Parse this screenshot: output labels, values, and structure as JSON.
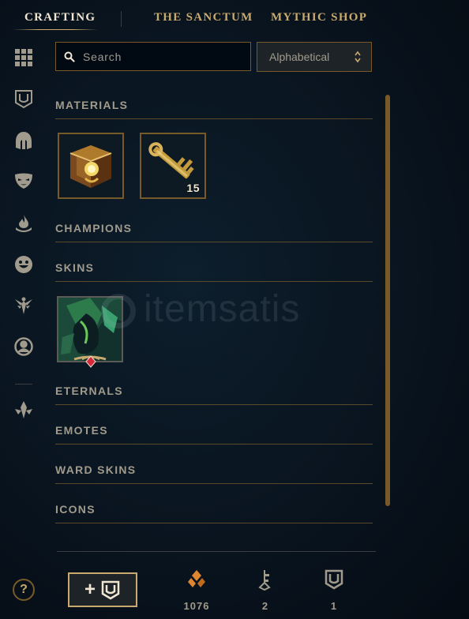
{
  "nav": {
    "tabs": [
      {
        "label": "CRAFTING",
        "active": true
      },
      {
        "label": "THE SANCTUM",
        "active": false
      },
      {
        "label": "MYTHIC SHOP",
        "active": false
      }
    ]
  },
  "sidebar": {
    "icons": [
      "grid-icon",
      "chest-icon",
      "helmet-icon",
      "mask-icon",
      "flame-icon",
      "smiley-icon",
      "ward-icon",
      "profile-icon",
      "emblem-icon"
    ]
  },
  "search": {
    "placeholder": "Search",
    "value": ""
  },
  "sort": {
    "selected": "Alphabetical"
  },
  "sections": {
    "materials": "MATERIALS",
    "champions": "CHAMPIONS",
    "skins": "SKINS",
    "eternals": "ETERNALS",
    "emotes": "EMOTES",
    "ward_skins": "WARD SKINS",
    "icons": "ICONS"
  },
  "materials": [
    {
      "name": "hextech-chest",
      "icon": "chest-icon",
      "count": ""
    },
    {
      "name": "hextech-key",
      "icon": "key-icon",
      "count": "15"
    }
  ],
  "skins": [
    {
      "name": "skin-shard",
      "icon": "skin-portrait",
      "badge": "red-gem"
    }
  ],
  "footer": {
    "help": "?",
    "add_label": "+",
    "currencies": [
      {
        "icon": "orange-essence-icon",
        "value": "1076",
        "color": "#e0852f"
      },
      {
        "icon": "key-fragment-icon",
        "value": "2",
        "color": "#a09b8c"
      },
      {
        "icon": "chest-icon",
        "value": "1",
        "color": "#a09b8c"
      }
    ]
  },
  "watermark": {
    "text": "itemsatis"
  },
  "colors": {
    "gold": "#c8aa6e",
    "gold_dark": "#785a28",
    "text": "#a09b8c",
    "bright": "#f0e6d2"
  }
}
